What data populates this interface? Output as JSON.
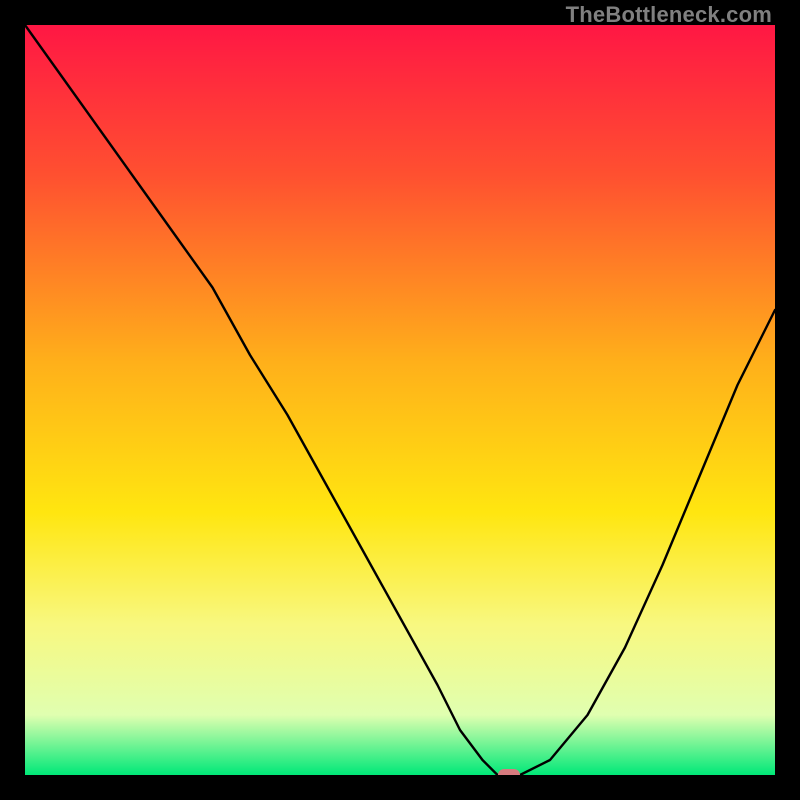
{
  "watermark": "TheBottleneck.com",
  "chart_data": {
    "type": "line",
    "title": "",
    "xlabel": "",
    "ylabel": "",
    "xlim": [
      0,
      100
    ],
    "ylim": [
      0,
      100
    ],
    "grid": false,
    "legend": false,
    "x": [
      0,
      5,
      10,
      15,
      20,
      25,
      30,
      35,
      40,
      45,
      50,
      55,
      58,
      61,
      63,
      66,
      70,
      75,
      80,
      85,
      90,
      95,
      100
    ],
    "values": [
      100,
      93,
      86,
      79,
      72,
      65,
      56,
      48,
      39,
      30,
      21,
      12,
      6,
      2,
      0,
      0,
      2,
      8,
      17,
      28,
      40,
      52,
      62
    ],
    "marker": {
      "x": 64.5,
      "y": 0
    },
    "gradient_stops": [
      {
        "pos": 0,
        "color": "#ff1744"
      },
      {
        "pos": 20,
        "color": "#ff5030"
      },
      {
        "pos": 45,
        "color": "#ffb01a"
      },
      {
        "pos": 65,
        "color": "#ffe610"
      },
      {
        "pos": 80,
        "color": "#f8f880"
      },
      {
        "pos": 92,
        "color": "#e0ffb0"
      },
      {
        "pos": 100,
        "color": "#00e878"
      }
    ]
  }
}
